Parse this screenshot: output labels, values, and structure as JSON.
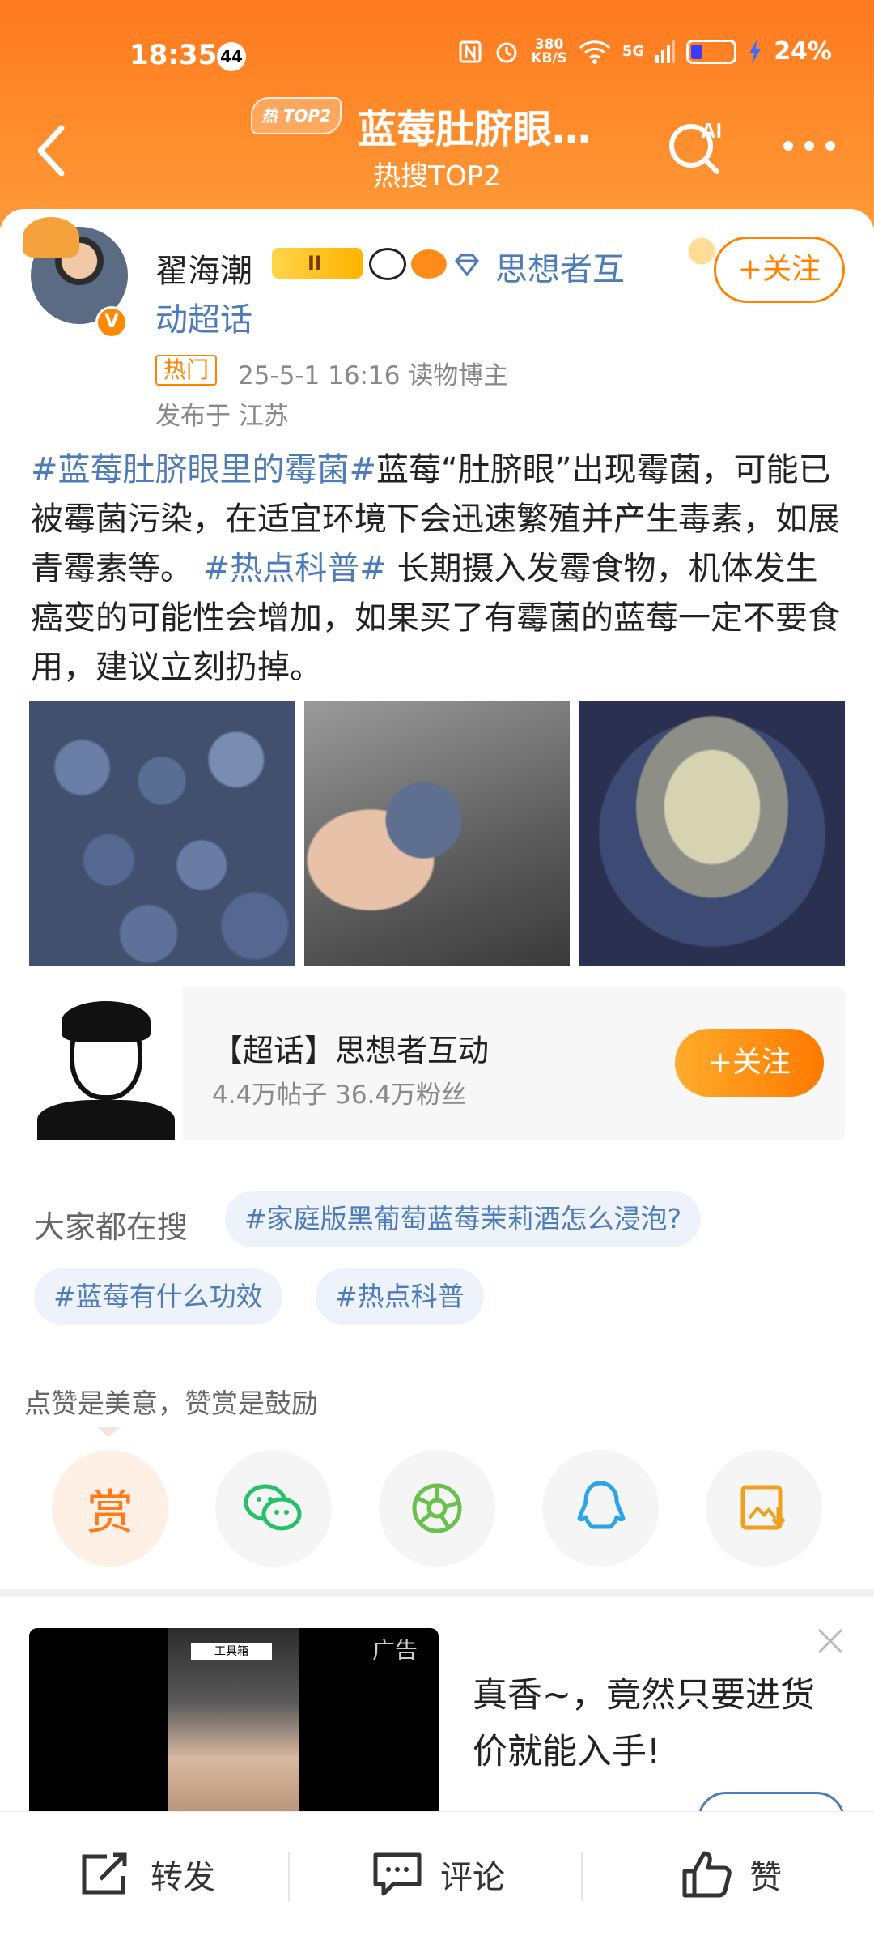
{
  "status_bar": {
    "time": "18:35",
    "notification_count": "44",
    "net_speed_value": "380",
    "net_speed_unit": "KB/S",
    "signal": "5G",
    "battery": "24%"
  },
  "header": {
    "hot_tag": "热 TOP2",
    "title": "蓝莓肚脐眼…",
    "subtitle": "热搜TOP2",
    "ai_label": "AI"
  },
  "post": {
    "author": "翟海潮",
    "level": "II",
    "supertopic_link": "思想者互动超话",
    "follow_label": "+关注",
    "hot_label": "热门",
    "time_and_source": "25-5-1 16:16   读物博主",
    "location": "发布于 江苏",
    "body": [
      {
        "text": "#蓝莓肚脐眼里的霉菌#",
        "tag": true
      },
      {
        "text": "蓝莓“肚脐眼”出现霉菌，可能已被霉菌污染，在适宜环境下会迅速繁殖并产生毒素，如展青霉素等。",
        "tag": false
      },
      {
        "text": " #热点科普# ",
        "tag": true
      },
      {
        "text": "长期摄入发霉食物，机体发生癌变的可能性会增加，如果买了有霉菌的蓝莓一定不要食用，建议立刻扔掉。",
        "tag": false
      }
    ]
  },
  "supertopic_card": {
    "title": "【超话】思想者互动",
    "stats": "4.4万帖子 36.4万粉丝",
    "follow_label": "+关注"
  },
  "related_search": {
    "label": "大家都在搜",
    "chips": [
      "#家庭版黑葡萄蓝莓茉莉酒怎么浸泡?",
      "#蓝莓有什么功效",
      "#热点科普"
    ]
  },
  "share": {
    "tip": "点赞是美意，赞赏是鼓励",
    "reward_label": "赏",
    "icons": [
      "wechat-icon",
      "moments-icon",
      "qq-icon",
      "save-image-icon"
    ]
  },
  "ad": {
    "label": "广告",
    "text": "真香~，竟然只要进货价就能入手!",
    "image_caption": "工具箱"
  },
  "bottom_bar": {
    "repost": "转发",
    "comment": "评论",
    "like": "赞"
  },
  "colors": {
    "header_orange": "#ff7a1f",
    "link_blue": "#4d7cb8",
    "accent_orange": "#ff8200"
  }
}
